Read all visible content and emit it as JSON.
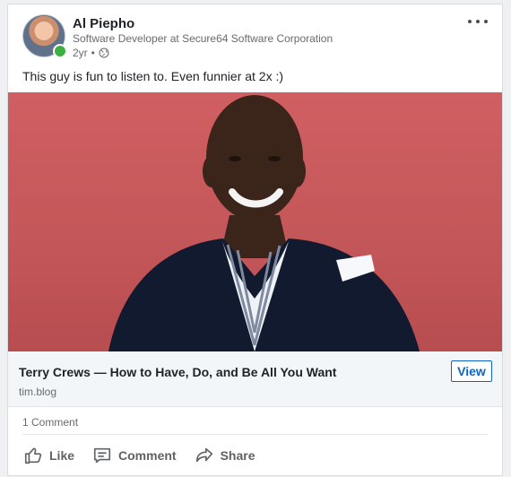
{
  "post": {
    "author_name": "Al Piepho",
    "author_headline": "Software Developer at Secure64 Software Corporation",
    "time_ago": "2yr",
    "meta_separator": "•",
    "text": "This guy is fun to listen to. Even funnier at 2x :)"
  },
  "link_preview": {
    "title": "Terry Crews — How to Have, Do, and Be All You Want",
    "domain": "tim.blog",
    "view_label": "View"
  },
  "social": {
    "comment_count_label": "1 Comment"
  },
  "actions": {
    "like_label": "Like",
    "comment_label": "Comment",
    "share_label": "Share"
  },
  "icons": {
    "more": "more-horizontal-icon",
    "visibility": "globe-icon",
    "like": "thumbs-up-icon",
    "comment": "comment-icon",
    "share": "share-arrow-icon"
  },
  "colors": {
    "brand": "#0a66c2",
    "presence": "#3cb043",
    "image_background": "#c95b5e"
  }
}
